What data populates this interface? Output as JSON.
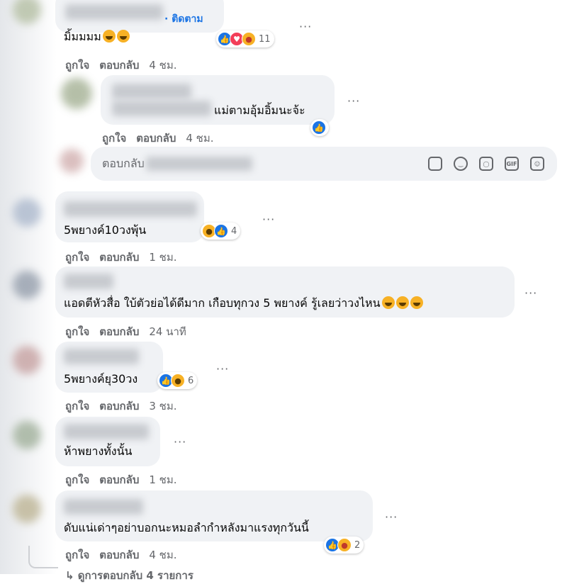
{
  "comments": [
    {
      "follow_label": "· ติดตาม",
      "text": "มิ้มมมม",
      "emoji_count": 2,
      "reaction_count": "11",
      "like": "ถูกใจ",
      "reply": "ตอบกลับ",
      "time": "4 ชม."
    },
    {
      "text": "แม่ตามอุ้มอิ้มนะจ้ะ",
      "like": "ถูกใจ",
      "reply": "ตอบกลับ",
      "time": "4 ชม."
    },
    {
      "text": "5พยางค์10วงพุ้น",
      "reaction_count": "4",
      "like": "ถูกใจ",
      "reply": "ตอบกลับ",
      "time": "1 ชม."
    },
    {
      "text": "แอดตีหัวสื่อ ใบ้ตัวย่อได้ดีมาก เกือบทุกวง 5 พยางค์ รู้เลยว่าวงไหน",
      "emoji_count": 3,
      "like": "ถูกใจ",
      "reply": "ตอบกลับ",
      "time": "24 นาที"
    },
    {
      "text": "5พยางค์ยุ30วง",
      "reaction_count": "6",
      "like": "ถูกใจ",
      "reply": "ตอบกลับ",
      "time": "3 ชม."
    },
    {
      "text": "ห้าพยางทั้งนั้น",
      "like": "ถูกใจ",
      "reply": "ตอบกลับ",
      "time": "1 ชม."
    },
    {
      "text": "ดับแน่เด่าๆอย่าบอกนะหมอลำกำหลังมาแรงทุกวันนี้",
      "reaction_count": "2",
      "like": "ถูกใจ",
      "reply": "ตอบกลับ",
      "time": "4 ชม."
    }
  ],
  "composer": {
    "placeholder": "ตอบกลับ",
    "tools": [
      "sticker-icon",
      "emoji-icon",
      "camera-icon",
      "gif-icon",
      "avatar-sticker-icon"
    ],
    "gif_label": "GIF"
  },
  "more_menu": "···",
  "bottom_link": "↳ ดูการตอบกลับ 4 รายการ",
  "colors": {
    "bubble": "#f0f2f5",
    "muted": "#65676b",
    "link": "#1b74e4",
    "like": "#1b74e4",
    "love": "#f33e58",
    "haha": "#f7b125"
  }
}
